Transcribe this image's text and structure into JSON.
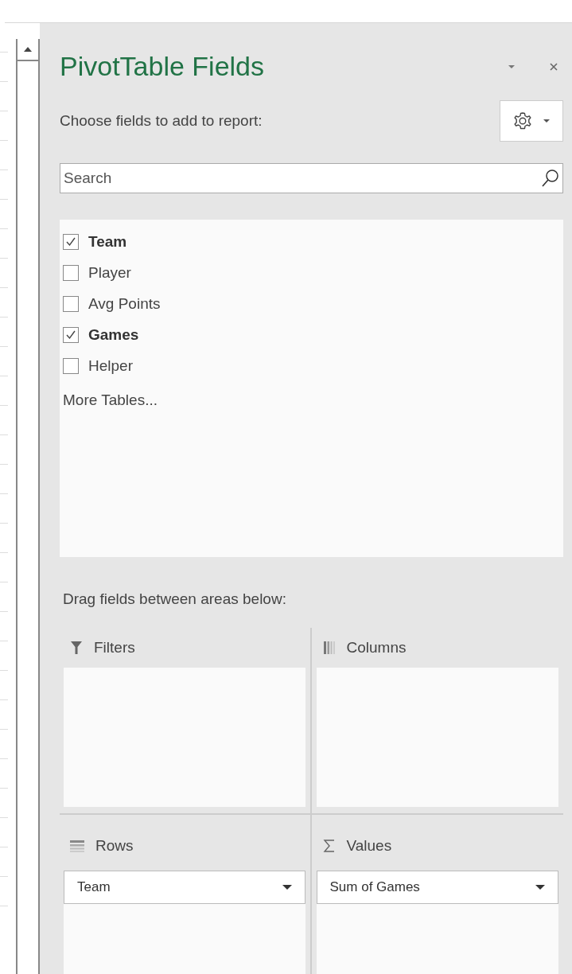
{
  "panel": {
    "title": "PivotTable Fields",
    "subtitle": "Choose fields to add to report:"
  },
  "search": {
    "placeholder": "Search"
  },
  "fields": [
    {
      "label": "Team",
      "checked": true
    },
    {
      "label": "Player",
      "checked": false
    },
    {
      "label": "Avg Points",
      "checked": false
    },
    {
      "label": "Games",
      "checked": true
    },
    {
      "label": "Helper",
      "checked": false
    }
  ],
  "more_tables": "More Tables...",
  "areas_hint": "Drag fields between areas below:",
  "areas": [
    {
      "kind": "filters",
      "label": "Filters"
    },
    {
      "kind": "columns",
      "label": "Columns"
    },
    {
      "kind": "rows",
      "label": "Rows",
      "items": [
        "Team"
      ]
    },
    {
      "kind": "values",
      "label": "Values",
      "items": [
        "Sum of Games"
      ]
    }
  ]
}
